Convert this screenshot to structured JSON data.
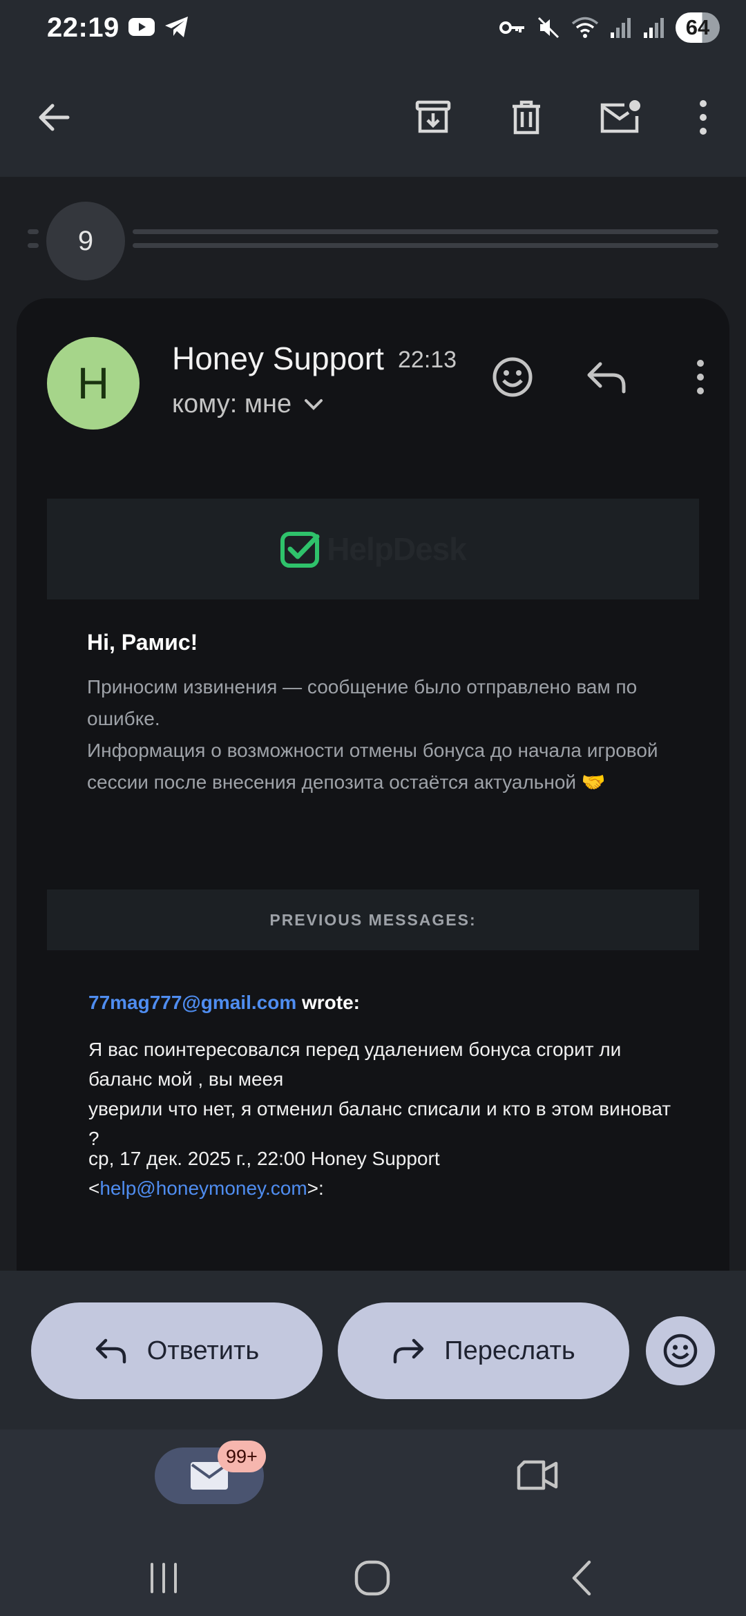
{
  "status_bar": {
    "time": "22:19",
    "battery": "64"
  },
  "app_bar": {
    "back": "back-arrow-icon",
    "archive": "archive-icon",
    "delete": "trash-icon",
    "mark_unread": "mark-unread-icon",
    "more": "more-vert-icon"
  },
  "thread": {
    "collapsed_count": "9"
  },
  "message": {
    "avatar_letter": "H",
    "sender": "Honey Support",
    "time": "22:13",
    "recipient": "кому: мне",
    "banner_logo": "HelpDesk",
    "greeting": "Hi, Рамис!",
    "body_lines": [
      "Приносим извинения — сообщение было отправлено вам по ошибке.",
      "Информация о возможности отмены бонуса до начала игровой сессии после внесения депозита остаётся актуальной 🤝"
    ],
    "previous_header": "PREVIOUS MESSAGES:",
    "quoted_email": "77mag777@gmail.com",
    "wrote": " wrote:",
    "quote_lines": [
      "Я вас поинтересовался перед удалением бонуса сгорит ли баланс мой , вы меея",
      "уверили что нет, я отменил баланс списали и кто в этом виноват ?"
    ],
    "date_line": "ср, 17 дек. 2025 г., 22:00 Honey Support",
    "reply_email_prefix": "<",
    "reply_email": "help@honeymoney.com",
    "reply_email_suffix": ">:"
  },
  "actions": {
    "reply_label": "Ответить",
    "forward_label": "Переслать"
  },
  "bottom_nav": {
    "mail_badge": "99+"
  },
  "colors": {
    "avatar": "#a6d58a",
    "link": "#4f8df0",
    "action_button": "#c3c8de",
    "badge": "#f6b6ae",
    "helpdesk_green": "#2fc26b"
  }
}
